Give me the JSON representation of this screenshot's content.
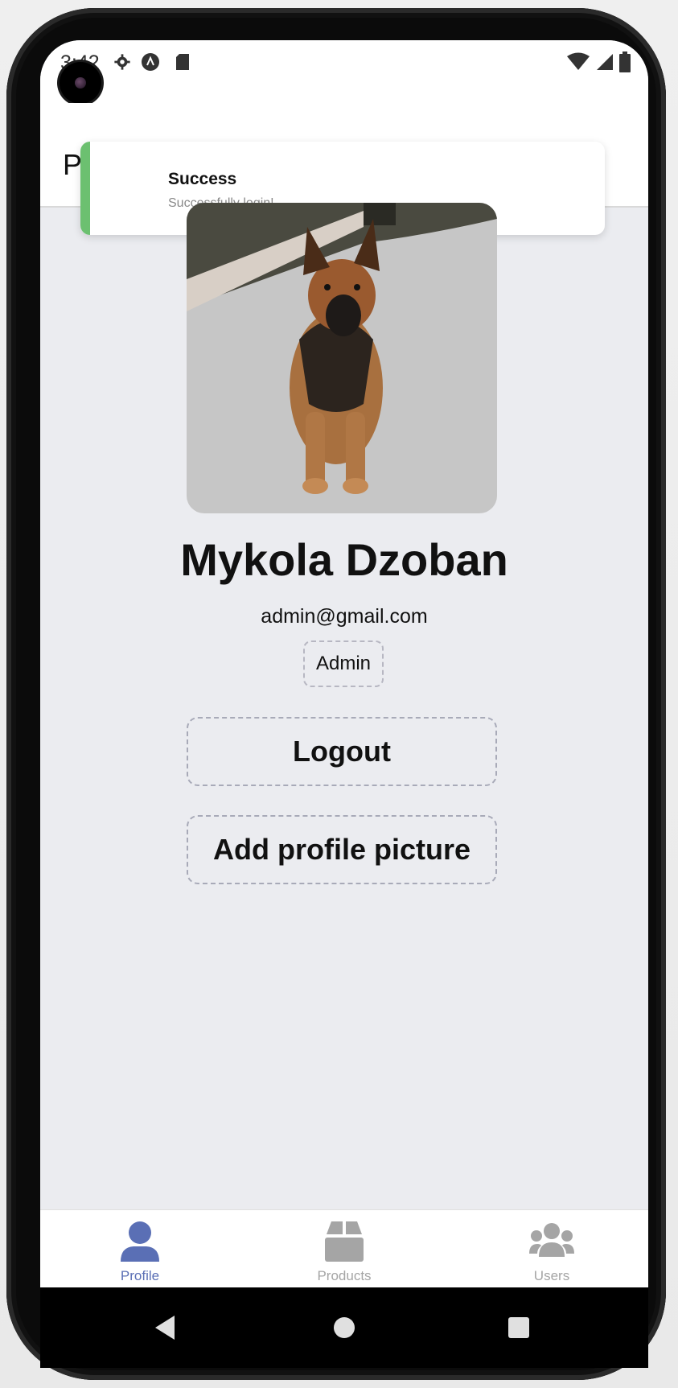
{
  "status_bar": {
    "time": "3:42",
    "left_icons": [
      "gear-icon",
      "app-badge-icon",
      "sd-card-icon"
    ],
    "right_icons": [
      "wifi-icon",
      "signal-icon",
      "battery-icon"
    ]
  },
  "header": {
    "title": "P"
  },
  "toast": {
    "title": "Success",
    "message": "Successfully login!",
    "accent_color": "#6cc070"
  },
  "profile": {
    "photo_icon": "profile-photo-dog",
    "name": "Mykola Dzoban",
    "email": "admin@gmail.com",
    "role": "Admin"
  },
  "actions": {
    "logout_label": "Logout",
    "add_picture_label": "Add profile picture"
  },
  "tabs": [
    {
      "label": "Profile",
      "icon": "user-icon",
      "active": true
    },
    {
      "label": "Products",
      "icon": "box-icon",
      "active": false
    },
    {
      "label": "Users",
      "icon": "users-icon",
      "active": false
    }
  ],
  "colors": {
    "screen_background": "#ebecf0",
    "active_tab": "#5a6fb5",
    "inactive_tab": "#a5a5a5"
  },
  "nav": {
    "icons": [
      "back-icon",
      "home-icon",
      "recents-icon"
    ]
  }
}
